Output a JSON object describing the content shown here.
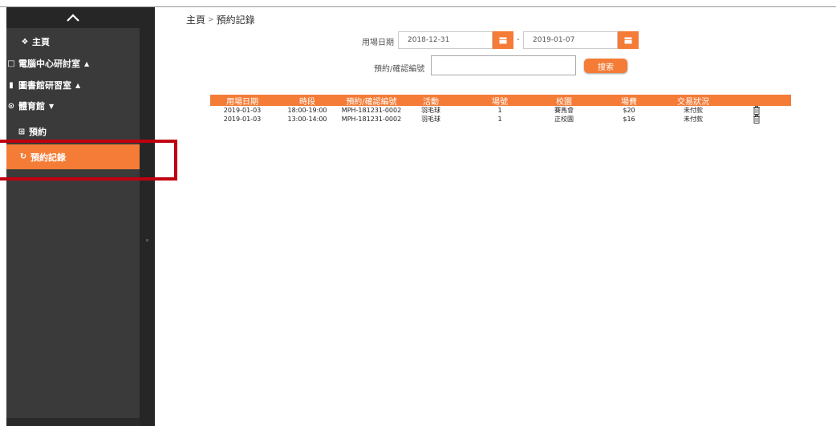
{
  "sidebar": {
    "items": [
      {
        "icon": "home-icon",
        "glyph": "❖",
        "label": "主頁",
        "caret": ""
      },
      {
        "icon": "monitor-icon",
        "glyph": "□",
        "label": "電腦中心研討室",
        "caret": "▲"
      },
      {
        "icon": "book-icon",
        "glyph": "▮",
        "label": "圖書館研習室",
        "caret": "▲"
      },
      {
        "icon": "soccer-ball-icon",
        "glyph": "⊙",
        "label": "體育館",
        "caret": "▼"
      },
      {
        "icon": "calendar-plus-icon",
        "glyph": "⊞",
        "label": "預約",
        "caret": ""
      },
      {
        "icon": "history-icon",
        "glyph": "↻",
        "label": "預約記錄",
        "caret": ""
      }
    ]
  },
  "breadcrumb": {
    "home": "主頁",
    "separator": ">",
    "current": "預約記錄"
  },
  "filters": {
    "date_label": "用場日期",
    "date_from": "2018-12-31",
    "date_sep": "-",
    "date_to": "2019-01-07",
    "ref_label": "預約/確認編號",
    "ref_value": "",
    "search_label": "搜索"
  },
  "table": {
    "headers": [
      "用場日期",
      "時段",
      "預約/確認編號",
      "活動",
      "場號",
      "校園",
      "場費",
      "交易狀況",
      ""
    ],
    "rows": [
      [
        "2019-01-03",
        "18:00-19:00",
        "MPH-181231-0002",
        "羽毛球",
        "1",
        "賽馬會",
        "$20",
        "未付款"
      ],
      [
        "2019-01-03",
        "13:00-14:00",
        "MPH-181231-0002",
        "羽毛球",
        "1",
        "正校園",
        "$16",
        "未付款"
      ]
    ]
  },
  "colors": {
    "accent": "#f47c37",
    "sidebar": "#3a3a3a",
    "highlight": "#c0000f"
  }
}
